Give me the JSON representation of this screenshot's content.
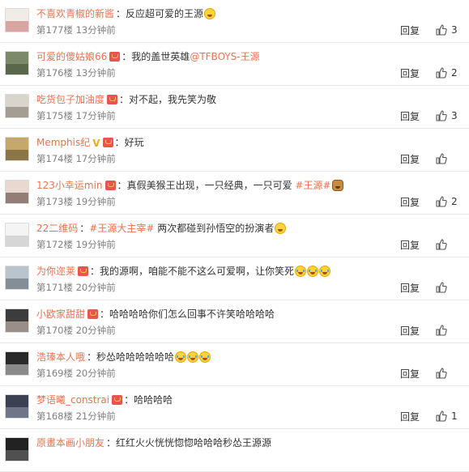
{
  "colors": {
    "username": "#eb7350",
    "meta": "#808080",
    "badge": "#e8554e",
    "divider": "#e8e8e8"
  },
  "comments": [
    {
      "user": "不喜欢青椒的新酱",
      "segments": [
        "反应超可爱的王源"
      ],
      "emojis": [
        "laugh"
      ],
      "floor": "第177楼",
      "time": "13分钟前",
      "reply": "回复",
      "likes": "3",
      "avatar": {
        "bg": "#f2ece6",
        "shade": "#c46b6b"
      },
      "badge": false,
      "vip": false
    },
    {
      "user": "可爱的傻姑娘66",
      "segments": [
        "我的盖世英雄",
        "@TFBOYS-王源"
      ],
      "emojis": [],
      "floor": "第176楼",
      "time": "13分钟前",
      "reply": "回复",
      "likes": "2",
      "avatar": {
        "bg": "#7d8a6a",
        "shade": "#3e4a32"
      },
      "badge": true,
      "vip": false
    },
    {
      "user": "吃货包子加油度",
      "segments": [
        "对不起，我先笑为敬"
      ],
      "emojis": [],
      "floor": "第175楼",
      "time": "17分钟前",
      "reply": "回复",
      "likes": "3",
      "avatar": {
        "bg": "#d9d4cc",
        "shade": "#7a6e62"
      },
      "badge": true,
      "vip": false
    },
    {
      "user": "Memphis纪",
      "segments": [
        "好玩"
      ],
      "emojis": [],
      "floor": "第174楼",
      "time": "17分钟前",
      "reply": "回复",
      "likes": "",
      "avatar": {
        "bg": "#c7a86b",
        "shade": "#5b4a2a"
      },
      "badge": true,
      "vip": true
    },
    {
      "user": "123小幸运min",
      "segments": [
        "真假美猴王出现，一只经典，一只可爱",
        "#王源#"
      ],
      "emojis": [
        "monkey"
      ],
      "floor": "第173楼",
      "time": "19分钟前",
      "reply": "回复",
      "likes": "2",
      "avatar": {
        "bg": "#e9d8cf",
        "shade": "#4a3530"
      },
      "badge": true,
      "vip": false
    },
    {
      "user": "22二维码",
      "segments": [
        "#王源大主宰#",
        "两次都碰到孙悟空的扮演者"
      ],
      "emojis": [
        "laugh"
      ],
      "floor": "第172楼",
      "time": "19分钟前",
      "reply": "回复",
      "likes": "",
      "avatar": {
        "bg": "#f4f4f4",
        "shade": "#bdbdbd"
      },
      "badge": false,
      "vip": false
    },
    {
      "user": "为你迩莱",
      "segments": [
        "我的源啊，咱能不能不这么可爱啊，让你笑死"
      ],
      "emojis": [
        "cry",
        "cry",
        "cry"
      ],
      "floor": "第171楼",
      "time": "20分钟前",
      "reply": "回复",
      "likes": "",
      "avatar": {
        "bg": "#b9c4cc",
        "shade": "#59636b"
      },
      "badge": true,
      "vip": false
    },
    {
      "user": "小欧家甜甜",
      "segments": [
        "哈哈哈哈你们怎么回事不许笑哈哈哈哈"
      ],
      "emojis": [],
      "floor": "第170楼",
      "time": "20分钟前",
      "reply": "回复",
      "likes": "",
      "avatar": {
        "bg": "#3c3c3c",
        "shade": "#e7d2c6"
      },
      "badge": true,
      "vip": false
    },
    {
      "user": "浩瑧本人哦",
      "segments": [
        "秒怂哈哈哈哈哈哈"
      ],
      "emojis": [
        "cry",
        "cry",
        "cry"
      ],
      "floor": "第169楼",
      "time": "20分钟前",
      "reply": "回复",
      "likes": "",
      "avatar": {
        "bg": "#2a2a2a",
        "shade": "#d9d9d9"
      },
      "badge": false,
      "vip": false
    },
    {
      "user": "梦语曦_constrai",
      "segments": [
        "哈哈哈哈"
      ],
      "emojis": [],
      "floor": "第168楼",
      "time": "21分钟前",
      "reply": "回复",
      "likes": "1",
      "avatar": {
        "bg": "#3b4150",
        "shade": "#9aa3b5"
      },
      "badge": true,
      "vip": false
    },
    {
      "user": "原畫本画小朋友",
      "segments": [
        "红红火火恍恍惚惚哈哈哈秒怂王源源"
      ],
      "emojis": [],
      "floor": "",
      "time": "",
      "reply": "",
      "likes": "",
      "avatar": {
        "bg": "#222222",
        "shade": "#777777"
      },
      "badge": false,
      "vip": false
    }
  ]
}
